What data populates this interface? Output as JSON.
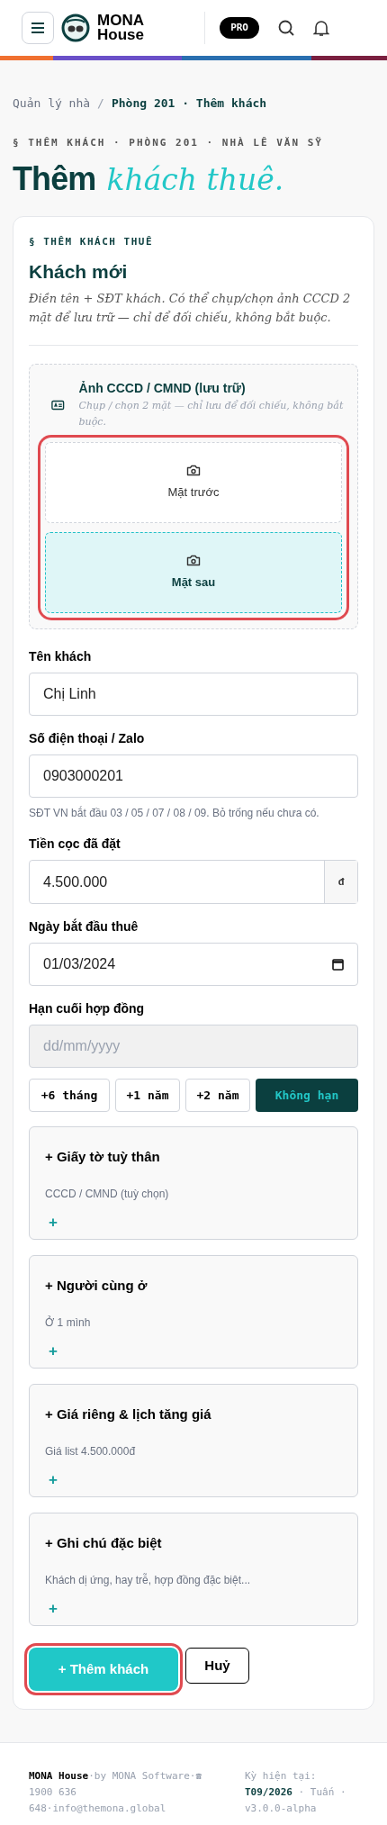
{
  "header": {
    "brand": [
      "MONA",
      "House"
    ],
    "badge": "PRO"
  },
  "breadcrumb": {
    "items": [
      {
        "label": "Quản lý nhà",
        "current": false
      },
      {
        "label": "Phòng 201 · Thêm khách",
        "current": true
      }
    ],
    "separator": "/"
  },
  "page": {
    "eyebrow": "§ THÊM KHÁCH · PHÒNG 201 · NHÀ LÊ VĂN SỸ",
    "title": "Thêm",
    "title_accent": "khách thuê."
  },
  "form": {
    "eyebrow": "§ THÊM KHÁCH THUÊ",
    "heading": "Khách mới",
    "description": "Điền tên + SĐT khách. Có thể chụp/chọn ảnh CCCD 2 mặt để lưu trữ — chỉ để đối chiếu, không bắt buộc.",
    "photos": {
      "title": "Ảnh CCCD / CMND (lưu trữ)",
      "hint": "Chụp / chọn 2 mặt — chỉ lưu để đối chiếu, không bắt buộc.",
      "highlighted": true,
      "sides": [
        {
          "label": "Mặt trước",
          "selected": false
        },
        {
          "label": "Mặt sau",
          "selected": true
        }
      ]
    },
    "fields": [
      {
        "kind": "text",
        "label": "Tên khách",
        "value": "Chị Linh"
      },
      {
        "kind": "text",
        "label": "Số điện thoại / Zalo",
        "value": "0903000201",
        "help": "SĐT VN bắt đầu 03 / 05 / 07 / 08 / 09. Bỏ trống nếu chưa có."
      },
      {
        "kind": "currency",
        "label": "Tiền cọc đã đặt",
        "value": "4.500.000",
        "suffix": "đ"
      },
      {
        "kind": "date",
        "label": "Ngày bắt đầu thuê",
        "value": "01/03/2024",
        "disabled": false
      },
      {
        "kind": "date",
        "label": "Hạn cuối hợp đồng",
        "placeholder": "dd/mm/yyyy",
        "disabled": true
      }
    ],
    "durations": [
      {
        "label": "+6 tháng",
        "selected": false
      },
      {
        "label": "+1 năm",
        "selected": false
      },
      {
        "label": "+2 năm",
        "selected": false
      },
      {
        "label": "Không hạn",
        "selected": true
      }
    ],
    "sections": [
      {
        "title": "+ Giấy tờ tuỳ thân",
        "summary": "CCCD / CMND (tuỳ chọn)",
        "add": "+"
      },
      {
        "title": "+ Người cùng ở",
        "summary": "Ở 1 mình",
        "add": "+"
      },
      {
        "title": "+ Giá riêng & lịch tăng giá",
        "summary": "Giá list 4.500.000đ",
        "add": "+"
      },
      {
        "title": "+ Ghi chú đặc biệt",
        "summary": "Khách dị ứng, hay trễ, hợp đồng đặc biệt...",
        "add": "+"
      }
    ],
    "submit": {
      "label": "+ Thêm khách",
      "highlighted": true
    },
    "cancel": "Huỷ"
  },
  "footer": {
    "info": "**MONA House**·by MONA Software·☎ 1900 636 648·info@themona.global",
    "period": "Kỳ hiện tại: **T09/2026** · Tuấn · v3.0.0-alpha"
  }
}
